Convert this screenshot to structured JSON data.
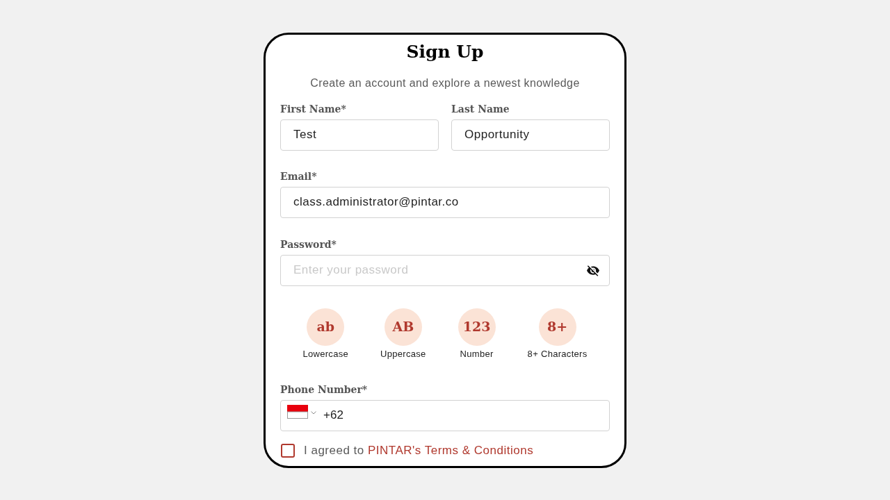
{
  "title": "Sign Up",
  "subtitle": "Create an account and explore a newest knowledge",
  "first_name": {
    "label": "First Name*",
    "value": "Test"
  },
  "last_name": {
    "label": "Last Name",
    "value": "Opportunity"
  },
  "email": {
    "label": "Email*",
    "value": "class.administrator@pintar.co"
  },
  "password": {
    "label": "Password*",
    "placeholder": "Enter your password",
    "visible": false
  },
  "password_rules": [
    {
      "symbol": "ab",
      "label": "Lowercase"
    },
    {
      "symbol": "AB",
      "label": "Uppercase"
    },
    {
      "symbol": "123",
      "label": "Number"
    },
    {
      "symbol": "8+",
      "label": "8+ Characters"
    }
  ],
  "phone": {
    "label": "Phone Number*",
    "value": "+62"
  },
  "terms": {
    "checked": false,
    "text": "I agreed to",
    "link": "PINTAR's Terms & Conditions"
  }
}
